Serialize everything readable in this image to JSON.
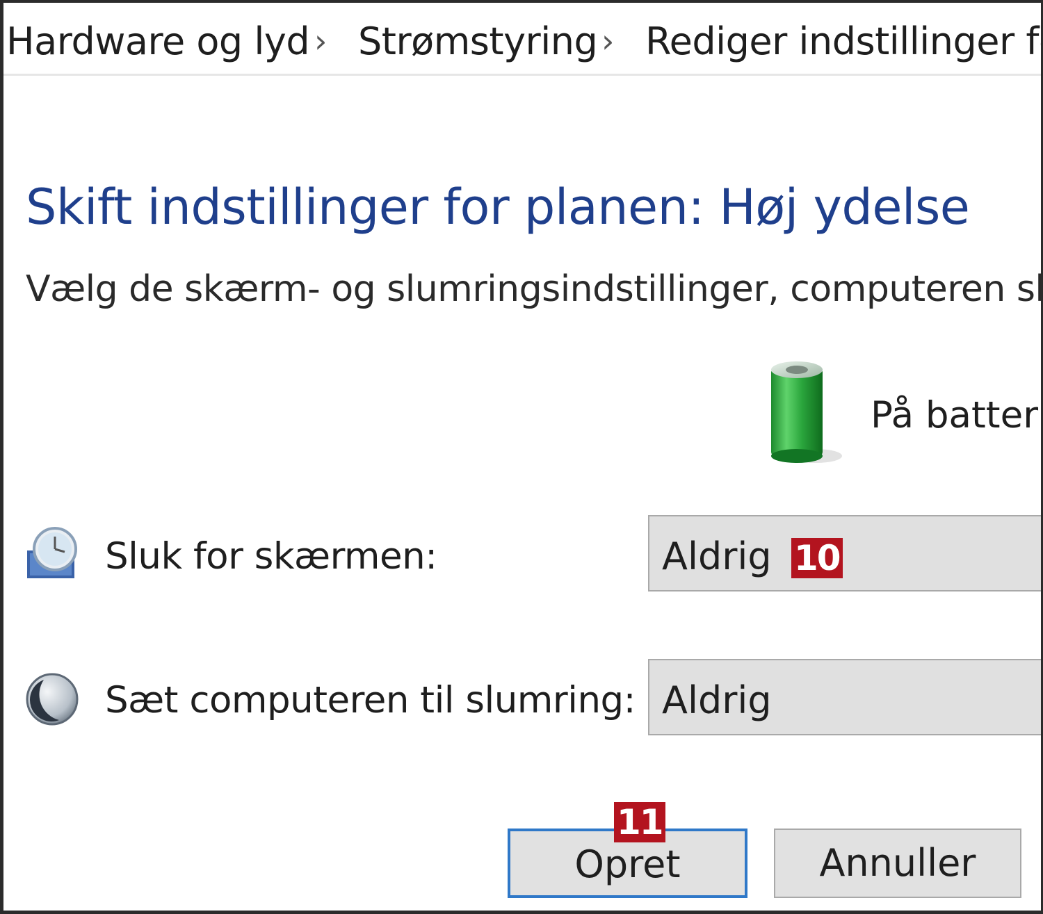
{
  "breadcrumb": {
    "items": [
      {
        "label": "Hardware og lyd"
      },
      {
        "label": "Strømstyring"
      },
      {
        "label": "Rediger indstillinger for"
      }
    ],
    "separator": "›"
  },
  "main": {
    "title": "Skift indstillinger for planen: Høj ydelse",
    "description": "Vælg de skærm- og slumringsindstillinger, computeren skal",
    "column_header": {
      "label": "På batteri",
      "icon": "battery-icon"
    },
    "settings": [
      {
        "label": "Sluk for skærmen:",
        "value": "Aldrig",
        "icon": "monitor-clock-icon"
      },
      {
        "label": "Sæt computeren til slumring:",
        "value": "Aldrig",
        "icon": "moon-sleep-icon"
      }
    ]
  },
  "buttons": {
    "create": "Opret",
    "cancel": "Annuller"
  },
  "annotations": {
    "badge_display_dropdown": "10",
    "badge_create_button": "11"
  },
  "colors": {
    "title": "#1f3f8c",
    "badge": "#b3141f",
    "primary_button_border": "#2f78c8"
  }
}
